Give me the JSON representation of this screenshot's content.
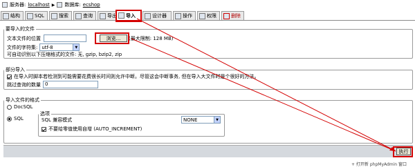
{
  "breadcrumb": {
    "server_label": "服务器:",
    "server_value": "localhost",
    "sep": "▶",
    "db_label": "数据库:",
    "db_value": "ecshop"
  },
  "tabs": [
    {
      "label": "结构",
      "icon": "structure-icon"
    },
    {
      "label": "SQL",
      "icon": "sql-icon"
    },
    {
      "label": "搜索",
      "icon": "search-icon"
    },
    {
      "label": "查询",
      "icon": "query-icon"
    },
    {
      "label": "导出",
      "icon": "export-icon"
    },
    {
      "label": "导入",
      "icon": "import-icon",
      "active": true
    },
    {
      "label": "设计器",
      "icon": "designer-icon"
    },
    {
      "label": "操作",
      "icon": "operations-icon"
    },
    {
      "label": "权限",
      "icon": "privileges-icon"
    },
    {
      "label": "删除",
      "icon": "drop-icon"
    }
  ],
  "import_file": {
    "legend": "要导入的文件",
    "location_label": "文本文件的位置",
    "browse_label": "浏览...",
    "max_size": "(最大限制: 128 MB)",
    "charset_label": "文件的字符集:",
    "charset_value": "utf-8",
    "compress_label": "可自动识别以下压缩格式的文件:",
    "compress_value": "无, gzip, bzip2, zip"
  },
  "partial_import": {
    "legend": "部分导入",
    "interrupt_label": "在导入时脚本若检测到可能需要花费很长时间则允许中断。尽管这会中断事务, 但在导入大文件时是个很好的方法。",
    "skip_label": "跳过查询的数量",
    "skip_value": "0"
  },
  "format": {
    "legend": "导入文件的格式",
    "docsql_label": "DocSQL",
    "sql_label": "SQL",
    "options_legend": "选项",
    "compat_label": "SQL 兼容模式",
    "compat_value": "NONE",
    "autoinc_label": "不要给零值使用自增 (AUTO_INCREMENT)"
  },
  "footer": {
    "go_label": "执行"
  },
  "hint": "+ 打开新 phpMyAdmin 窗口"
}
